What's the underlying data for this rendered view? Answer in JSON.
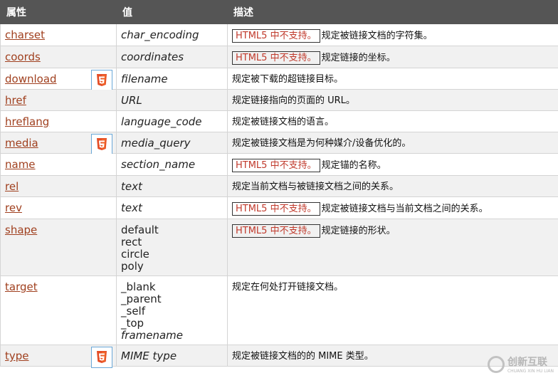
{
  "header": {
    "col1": "属性",
    "col2": "值",
    "col3": "描述"
  },
  "unsupported_label": "HTML5 中不支持。",
  "rows": [
    {
      "attr": "charset",
      "value": [
        "char_encoding"
      ],
      "unsupported": true,
      "html5": false,
      "desc": "规定被链接文档的字符集。"
    },
    {
      "attr": "coords",
      "value": [
        "coordinates"
      ],
      "unsupported": true,
      "html5": false,
      "desc": "规定链接的坐标。"
    },
    {
      "attr": "download",
      "value": [
        "filename"
      ],
      "unsupported": false,
      "html5": true,
      "desc": "规定被下载的超链接目标。"
    },
    {
      "attr": "href",
      "value": [
        "URL"
      ],
      "unsupported": false,
      "html5": false,
      "desc": "规定链接指向的页面的 URL。"
    },
    {
      "attr": "hreflang",
      "value": [
        "language_code"
      ],
      "unsupported": false,
      "html5": false,
      "desc": "规定被链接文档的语言。"
    },
    {
      "attr": "media",
      "value": [
        "media_query"
      ],
      "unsupported": false,
      "html5": true,
      "desc": "规定被链接文档是为何种媒介/设备优化的。"
    },
    {
      "attr": "name",
      "value": [
        "section_name"
      ],
      "unsupported": true,
      "html5": false,
      "desc": "规定锚的名称。"
    },
    {
      "attr": "rel",
      "value": [
        "text"
      ],
      "unsupported": false,
      "html5": false,
      "desc": "规定当前文档与被链接文档之间的关系。"
    },
    {
      "attr": "rev",
      "value": [
        "text"
      ],
      "unsupported": true,
      "html5": false,
      "desc": "规定被链接文档与当前文档之间的关系。"
    },
    {
      "attr": "shape",
      "value": [
        "default",
        "rect",
        "circle",
        "poly"
      ],
      "plain": true,
      "unsupported": true,
      "html5": false,
      "desc": "规定链接的形状。"
    },
    {
      "attr": "target",
      "value": [
        "_blank",
        "_parent",
        "_self",
        "_top",
        "framename"
      ],
      "plain_except_last": true,
      "unsupported": false,
      "html5": false,
      "desc": "规定在何处打开链接文档。"
    },
    {
      "attr": "type",
      "value": [
        "MIME type"
      ],
      "unsupported": false,
      "html5": true,
      "desc": "规定被链接文档的的 MIME 类型。"
    }
  ],
  "watermark": {
    "main": "创新互联",
    "sub": "CHUANG XIN HU LIAN"
  }
}
